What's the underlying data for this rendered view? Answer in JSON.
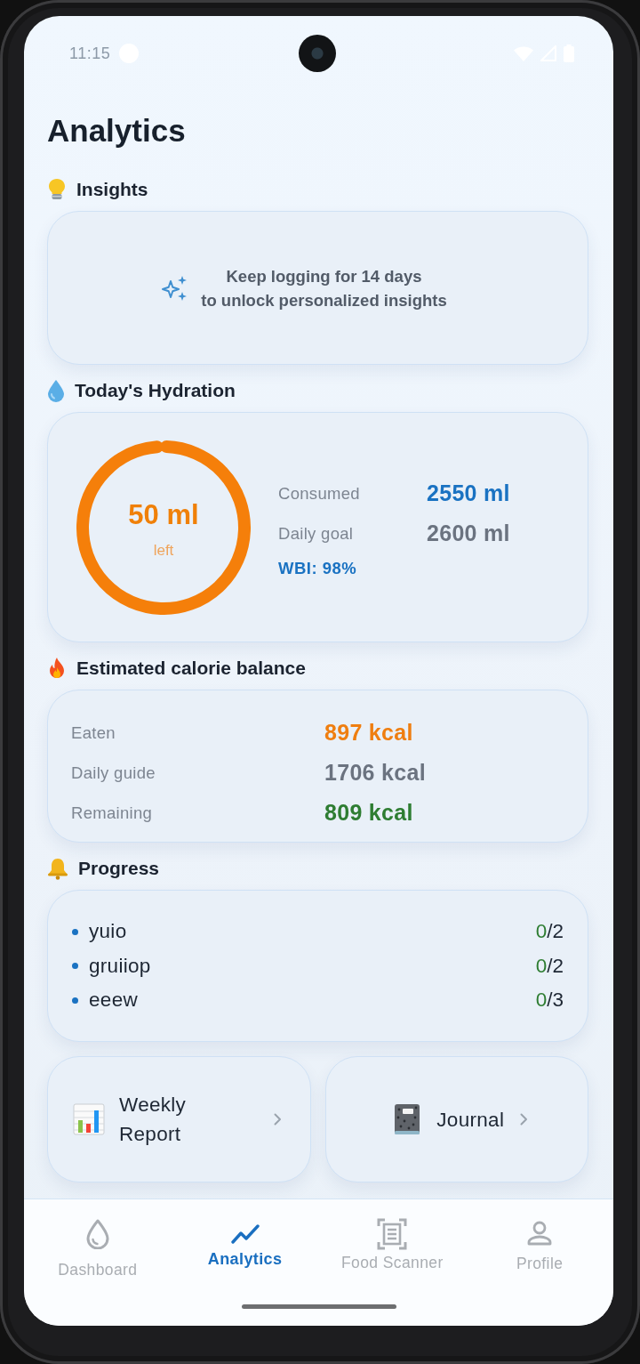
{
  "status_bar": {
    "time": "11:15"
  },
  "title": "Analytics",
  "insights": {
    "heading": "Insights",
    "message_lines": [
      "Keep logging for 14 days",
      "to unlock personalized insights"
    ]
  },
  "hydration": {
    "heading": "Today's Hydration",
    "ring": {
      "level": 0.98,
      "amount": "50 ml",
      "caption": "left"
    },
    "stats": [
      {
        "label": "Consumed",
        "value": "2550 ml",
        "color": "#1a72c2"
      },
      {
        "label": "Daily goal",
        "value": "2600 ml",
        "color": "#6b7380"
      }
    ],
    "index": "WBI: 98%"
  },
  "calories": {
    "heading": "Estimated calorie balance",
    "rows": [
      {
        "label": "Eaten",
        "value": "897 kcal",
        "color": "#ef7e10"
      },
      {
        "label": "Daily guide",
        "value": "1706 kcal",
        "color": "#6b7380"
      },
      {
        "label": "Remaining",
        "value": "809 kcal",
        "color": "#2e7d32"
      }
    ]
  },
  "progress": {
    "heading": "Progress",
    "items": [
      {
        "name": "yuio",
        "done": "0",
        "total": "/2"
      },
      {
        "name": "gruiiop",
        "done": "0",
        "total": "/2"
      },
      {
        "name": "eeew",
        "done": "0",
        "total": "/3"
      }
    ]
  },
  "links": [
    {
      "kind": "report",
      "label": "Weekly Report"
    },
    {
      "kind": "journal",
      "label": "Journal"
    }
  ],
  "nav": {
    "items": [
      {
        "kind": "dashboard",
        "label": "Dashboard",
        "selected": false
      },
      {
        "kind": "analytics",
        "label": "Analytics",
        "selected": true
      },
      {
        "kind": "scanner",
        "label": "Food Scanner",
        "selected": false
      },
      {
        "kind": "profile",
        "label": "Profile",
        "selected": false
      }
    ]
  }
}
